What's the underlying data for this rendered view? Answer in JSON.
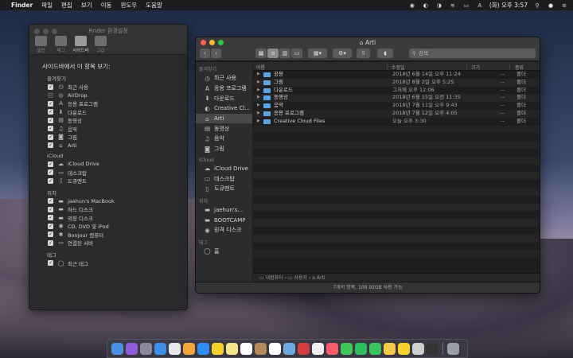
{
  "menubar": {
    "apple": "",
    "items": [
      "Finder",
      "파일",
      "편집",
      "보기",
      "이동",
      "윈도우",
      "도움말"
    ],
    "status": {
      "clock": "(화) 오후 3:57"
    }
  },
  "prefs": {
    "title": "Finder 환경설정",
    "tabs": [
      "일반",
      "태그",
      "사이드바",
      "고급"
    ],
    "heading": "사이드바에서 이 항목 보기:",
    "sections": [
      {
        "label": "즐겨찾기",
        "items": [
          {
            "label": "최근 사용",
            "checked": true,
            "icon": "clock-icon"
          },
          {
            "label": "AirDrop",
            "checked": false,
            "icon": "airdrop-icon"
          },
          {
            "label": "응용 프로그램",
            "checked": true,
            "icon": "apps-icon"
          },
          {
            "label": "다운로드",
            "checked": true,
            "icon": "download-icon"
          },
          {
            "label": "동영상",
            "checked": true,
            "icon": "movie-icon"
          },
          {
            "label": "음악",
            "checked": true,
            "icon": "music-icon"
          },
          {
            "label": "그림",
            "checked": true,
            "icon": "camera-icon"
          },
          {
            "label": "Arti",
            "checked": true,
            "icon": "home-icon"
          }
        ]
      },
      {
        "label": "iCloud",
        "items": [
          {
            "label": "iCloud Drive",
            "checked": true,
            "icon": "cloud-icon"
          },
          {
            "label": "데스크탑",
            "checked": true,
            "icon": "desktop-icon"
          },
          {
            "label": "도큐멘트",
            "checked": true,
            "icon": "document-icon"
          }
        ]
      },
      {
        "label": "위치",
        "items": [
          {
            "label": "jaehun's MacBook",
            "checked": true,
            "icon": "laptop-icon"
          },
          {
            "label": "하드 디스크",
            "checked": true,
            "icon": "disk-icon"
          },
          {
            "label": "외장 디스크",
            "checked": true,
            "icon": "external-disk-icon"
          },
          {
            "label": "CD, DVD 및 iPod",
            "checked": true,
            "icon": "cd-icon"
          },
          {
            "label": "Bonjour 컴퓨터",
            "checked": true,
            "icon": "bonjour-icon"
          },
          {
            "label": "연결된 서버",
            "checked": true,
            "icon": "server-icon"
          }
        ]
      },
      {
        "label": "태그",
        "items": [
          {
            "label": "최근 태그",
            "checked": true,
            "icon": "tag-icon"
          }
        ]
      }
    ]
  },
  "finder": {
    "title": "Arti",
    "search_placeholder": "검색",
    "sidebar": [
      {
        "section": "즐겨찾기",
        "items": [
          {
            "label": "최근 사용",
            "icon": "clock-icon"
          },
          {
            "label": "응용 프로그램",
            "icon": "apps-icon"
          },
          {
            "label": "다운로드",
            "icon": "download-icon"
          },
          {
            "label": "Creative Cl...",
            "icon": "cc-icon"
          },
          {
            "label": "Arti",
            "icon": "home-icon",
            "selected": true
          },
          {
            "label": "동영상",
            "icon": "movie-icon"
          },
          {
            "label": "음악",
            "icon": "music-icon"
          },
          {
            "label": "그림",
            "icon": "camera-icon"
          }
        ]
      },
      {
        "section": "iCloud",
        "items": [
          {
            "label": "iCloud Drive",
            "icon": "cloud-icon"
          },
          {
            "label": "데스크탑",
            "icon": "desktop-icon"
          },
          {
            "label": "도큐멘트",
            "icon": "document-icon"
          }
        ]
      },
      {
        "section": "위치",
        "items": [
          {
            "label": "jaehun's...",
            "icon": "laptop-icon"
          },
          {
            "label": "BOOTCAMP",
            "icon": "disk-icon"
          },
          {
            "label": "원격 디스크",
            "icon": "cd-icon"
          }
        ]
      },
      {
        "section": "태그",
        "items": [
          {
            "label": "홈",
            "icon": "tag-icon"
          }
        ]
      }
    ],
    "columns": {
      "name": "이름",
      "date": "수정일",
      "size": "크기",
      "kind": "종류"
    },
    "rows": [
      {
        "name": "공용",
        "date": "2018년 6월 14일 오후 11:24",
        "size": "--",
        "kind": "폴더"
      },
      {
        "name": "그림",
        "date": "2018년 8월 2일 오후 5:25",
        "size": "--",
        "kind": "폴더"
      },
      {
        "name": "다운로드",
        "date": "그저께 오후 12:06",
        "size": "--",
        "kind": "폴더"
      },
      {
        "name": "동영상",
        "date": "2018년 6월 15일 오전 11:35",
        "size": "--",
        "kind": "폴더"
      },
      {
        "name": "음악",
        "date": "2018년 7월 11일 오후 9:43",
        "size": "--",
        "kind": "폴더"
      },
      {
        "name": "응용 프로그램",
        "date": "2018년 7월 12일 오후 4:05",
        "size": "--",
        "kind": "폴더"
      },
      {
        "name": "Creative Cloud Files",
        "date": "오늘 오후 3:30",
        "size": "--",
        "kind": "폴더"
      }
    ],
    "pathbar": [
      "내컴퓨터",
      "사용자",
      "Arti"
    ],
    "status": "7개의 항목, 108.92GB 사용 가능"
  },
  "dock": {
    "apps": [
      "finder",
      "siri",
      "launchpad",
      "safari",
      "chrome",
      "photos",
      "appstore",
      "kakaotalk",
      "notes",
      "calendar",
      "contacts",
      "reminders",
      "preview",
      "photobooth",
      "itunes",
      "music",
      "facetime",
      "evernote",
      "line",
      "folder",
      "kakaotalk-2",
      "textedit",
      "terminal",
      "trash"
    ]
  }
}
